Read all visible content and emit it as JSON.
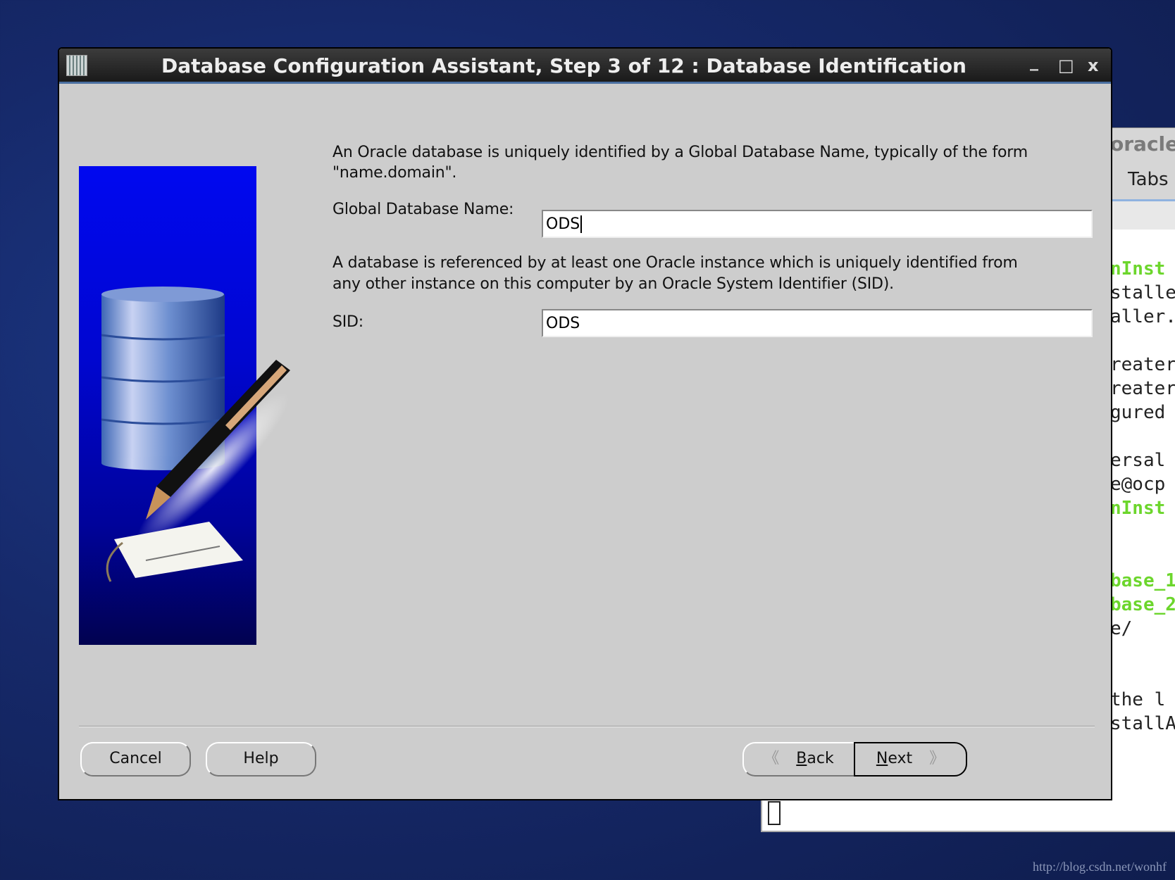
{
  "background_window": {
    "title": "oracle",
    "menu": "Tabs",
    "lines": [
      {
        "text": "nInst",
        "green": true
      },
      {
        "text": "stalle",
        "green": false
      },
      {
        "text": "aller.",
        "green": false
      },
      {
        "text": "reater",
        "green": false
      },
      {
        "text": "reater",
        "green": false
      },
      {
        "text": "gured",
        "green": false
      },
      {
        "text": "ersal",
        "green": false
      },
      {
        "text": "e@ocp",
        "green": false
      },
      {
        "text": "nInst",
        "green": true
      },
      {
        "text": "base_1",
        "green": true
      },
      {
        "text": "base_2",
        "green": true
      },
      {
        "text": "e/",
        "green": false
      },
      {
        "text": "the l",
        "green": false
      },
      {
        "text": "stallA",
        "green": false
      }
    ]
  },
  "watermark": "http://blog.csdn.net/wonhf",
  "dialog": {
    "title": "Database Configuration Assistant, Step 3 of 12 : Database Identification",
    "window_controls": {
      "minimize": "_",
      "maximize": "□",
      "close": "x"
    },
    "intro_line1": "An Oracle database is uniquely identified by a Global Database Name, typically of the form",
    "intro_line2": "\"name.domain\".",
    "global_db_label": "Global Database Name:",
    "global_db_value": "ODS",
    "sid_info_line1": "A database is referenced by at least one Oracle instance which is uniquely identified from",
    "sid_info_line2": "any other instance on this computer by an Oracle System Identifier (SID).",
    "sid_label": "SID:",
    "sid_value": "ODS",
    "buttons": {
      "cancel": "Cancel",
      "help": "Help",
      "back": "Back",
      "back_mnemonic": "B",
      "back_rest": "ack",
      "next_mnemonic": "N",
      "next_rest": "ext"
    }
  }
}
